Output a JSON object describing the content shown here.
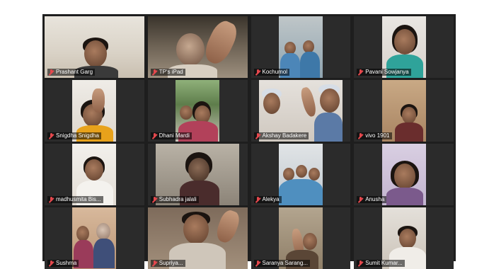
{
  "meeting": {
    "participants": [
      {
        "name": "Prashant Garg"
      },
      {
        "name": "TP's iPad"
      },
      {
        "name": "Kochumol"
      },
      {
        "name": "Pavani Sowjanya"
      },
      {
        "name": "Snigdha Snigdha"
      },
      {
        "name": "Dhani Mardi"
      },
      {
        "name": "Akshay Badakere"
      },
      {
        "name": "vivo 1901"
      },
      {
        "name": "madhusmita Bis..."
      },
      {
        "name": "Subhadra jalali"
      },
      {
        "name": "Alekya"
      },
      {
        "name": "Anusha"
      },
      {
        "name": "Sushma"
      },
      {
        "name": "Supriya..."
      },
      {
        "name": "Saranya Sarang..."
      },
      {
        "name": "Sumit Kumar..."
      }
    ],
    "muted_icon": "mic-muted-icon",
    "colors": {
      "background": "#1e1e1e",
      "tile": "#2b2b2b",
      "muted": "#e5484d"
    }
  }
}
